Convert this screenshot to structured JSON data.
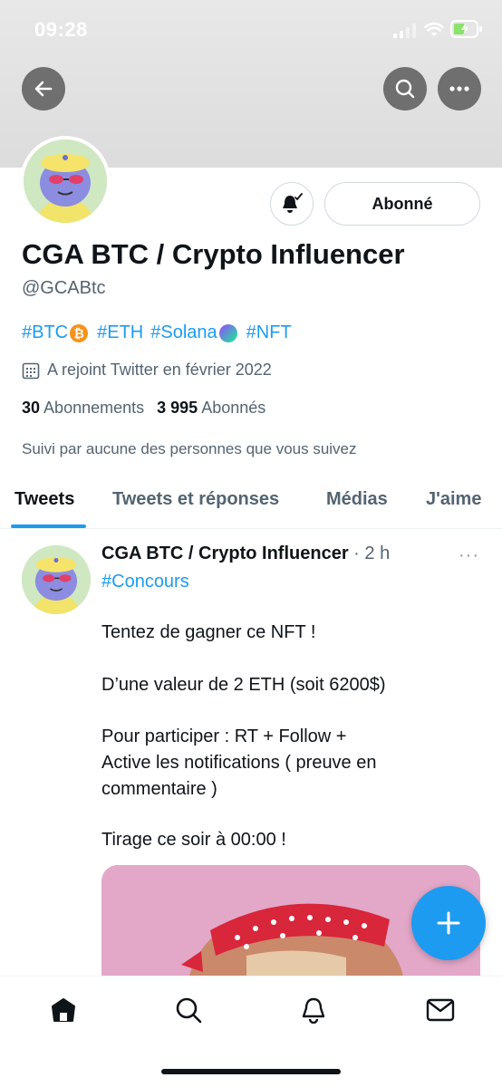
{
  "status_bar": {
    "time": "09:28"
  },
  "header": {
    "back_icon": "arrow-left-icon",
    "search_icon": "search-icon",
    "more_icon": "more-horizontal-icon"
  },
  "profile": {
    "display_name": "CGA BTC / Crypto Influencer",
    "handle": "@GCABtc",
    "follow_button_label": "Abonné",
    "bell_icon": "notification-bell-icon",
    "bio": {
      "tag_btc": "#BTC",
      "btc_symbol": "₿",
      "tag_eth": "#ETH",
      "tag_solana": "#Solana",
      "tag_nft": "#NFT"
    },
    "joined": "A rejoint Twitter en février 2022",
    "following_count": "30",
    "following_label": "Abonnements",
    "followers_count": "3 995",
    "followers_label": "Abonnés",
    "followed_by": "Suivi par aucune des personnes que vous suivez"
  },
  "tabs": [
    {
      "label": "Tweets",
      "active": true
    },
    {
      "label": "Tweets et réponses",
      "active": false
    },
    {
      "label": "Médias",
      "active": false
    },
    {
      "label": "J'aime",
      "active": false
    }
  ],
  "tweet": {
    "name": "CGA BTC / Crypto Influencer",
    "separator": " · ",
    "time": "2 h",
    "more": "···",
    "hashtag": "#Concours",
    "lines": [
      "Tentez de gagner ce NFT !",
      "D’une valeur de 2 ETH (soit 6200$)",
      "Pour participer : RT + Follow +",
      "Active les notifications ( preuve en",
      "commentaire )",
      "Tirage ce soir à 00:00 !"
    ]
  },
  "fab": {
    "icon": "plus-icon"
  },
  "bottom_nav": [
    "home-icon",
    "search-icon",
    "notifications-icon",
    "messages-icon"
  ],
  "colors": {
    "accent": "#1d9bf0",
    "text": "#0f1419",
    "muted": "#536471"
  }
}
